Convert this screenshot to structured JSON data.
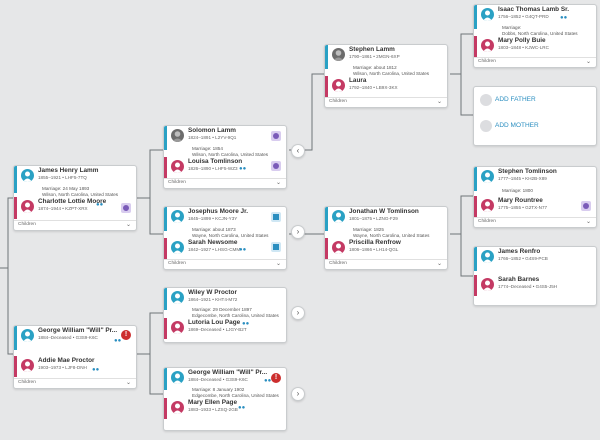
{
  "labels": {
    "children": "Children",
    "add_father": "ADD FATHER",
    "add_mother": "ADD MOTHER"
  },
  "families": [
    {
      "id": "james",
      "husband": {
        "name": "James Henry Lamm",
        "dates": "1855–1921 • LHF5-7TQ"
      },
      "marriage": [
        "Marriage: 24 May 1893",
        "Wilson, North Carolina, United States"
      ],
      "wife": {
        "name": "Charlotte Lottie Moore",
        "dates": "1874–1944 • KZPT-XRX"
      }
    },
    {
      "id": "solomon",
      "husband": {
        "name": "Solomon Lamm",
        "dates": "1824–1891 • L2YV-9Q1"
      },
      "marriage": [
        "Marriage: 1854",
        "Wilson, North Carolina, United States"
      ],
      "wife": {
        "name": "Louisa Tomlinson",
        "dates": "1826–1890 • LHF5-WZ3"
      }
    },
    {
      "id": "josephus",
      "husband": {
        "name": "Josephus Moore Jr.",
        "dates": "1845–1899 • KCJN-Y3Y"
      },
      "marriage": [
        "Marriage: about 1873",
        "Wayne, North Carolina, United States"
      ],
      "wife": {
        "name": "Sarah Newsome",
        "dates": "1842–1927 • LHSG-CMM"
      }
    },
    {
      "id": "stephen_lamm",
      "husband": {
        "name": "Stephen Lamm",
        "dates": "1790–1861 • 2MGN-6XP"
      },
      "marriage": [
        "Marriage: about 1812",
        "Wilson, North Carolina, United States"
      ],
      "wife": {
        "name": "Laura",
        "dates": "1792–1840 • LB9X-3KX"
      }
    },
    {
      "id": "isaac",
      "husband": {
        "name": "Isaac Thomas Lamb Sr.",
        "dates": "1756–1852 • G4QT-PRD"
      },
      "marriage": [
        "Marriage:",
        "Dobbs, North Carolina, United States"
      ],
      "wife": {
        "name": "Mary Polly Buie",
        "dates": "1803–1848 • KJWC-LRC"
      }
    },
    {
      "id": "jonathan",
      "husband": {
        "name": "Jonathan W Tomlinson",
        "dates": "1801–1875 • LZNG-F29"
      },
      "marriage": [
        "Marriage: 1825",
        "Wayne, North Carolina, United States"
      ],
      "wife": {
        "name": "Priscilla Renfrow",
        "dates": "1806–1866 • LH14-QGL"
      }
    },
    {
      "id": "stephen_tom",
      "husband": {
        "name": "Stephen Tomlinson",
        "dates": "1777–1845 • KH2B-X89"
      },
      "marriage": [
        "Marriage: 1800"
      ],
      "wife": {
        "name": "Mary Rountree",
        "dates": "1775–1855 • G2TX-N77"
      }
    },
    {
      "id": "james_renfro",
      "husband": {
        "name": "James Renfro",
        "dates": "1766–1852 • G4S9-PCB"
      },
      "marriage": [],
      "wife": {
        "name": "Sarah Barnes",
        "dates": "1774–Deceased • G4S5-J5H"
      }
    },
    {
      "id": "george_main",
      "husband": {
        "name": "George William \"Will\" Pr...",
        "dates": "1884–Deceased • G3S9-K6C"
      },
      "marriage": [],
      "wife": {
        "name": "Addie Mae Proctor",
        "dates": "1903–1973 • LJF8-DNH"
      }
    },
    {
      "id": "wiley",
      "husband": {
        "name": "Wiley W Proctor",
        "dates": "1864–1921 • KHT4-M72"
      },
      "marriage": [
        "Marriage: 29 December 1897",
        "Edgecombe, North Carolina, United States"
      ],
      "wife": {
        "name": "Lutoria Lou Page",
        "dates": "1869–Deceased • LJGY-B2T"
      }
    },
    {
      "id": "george_right",
      "husband": {
        "name": "George William \"Will\" Pr...",
        "dates": "1884–Deceased • G3S9-K6C"
      },
      "marriage": [
        "Marriage: 8 January 1902",
        "Edgecombe, North Carolina, United States"
      ],
      "wife": {
        "name": "Mary Ellen Page",
        "dates": "1883–1933 • LZSQ-2GB"
      }
    }
  ],
  "colors": {
    "male_accent": "#2aa1c4",
    "female_accent": "#c43a64",
    "badge_purple": "#d8ccef",
    "badge_blue": "#cfe7f4",
    "alert_red": "#cc2e2e",
    "link_blue": "#2a8ec0"
  }
}
